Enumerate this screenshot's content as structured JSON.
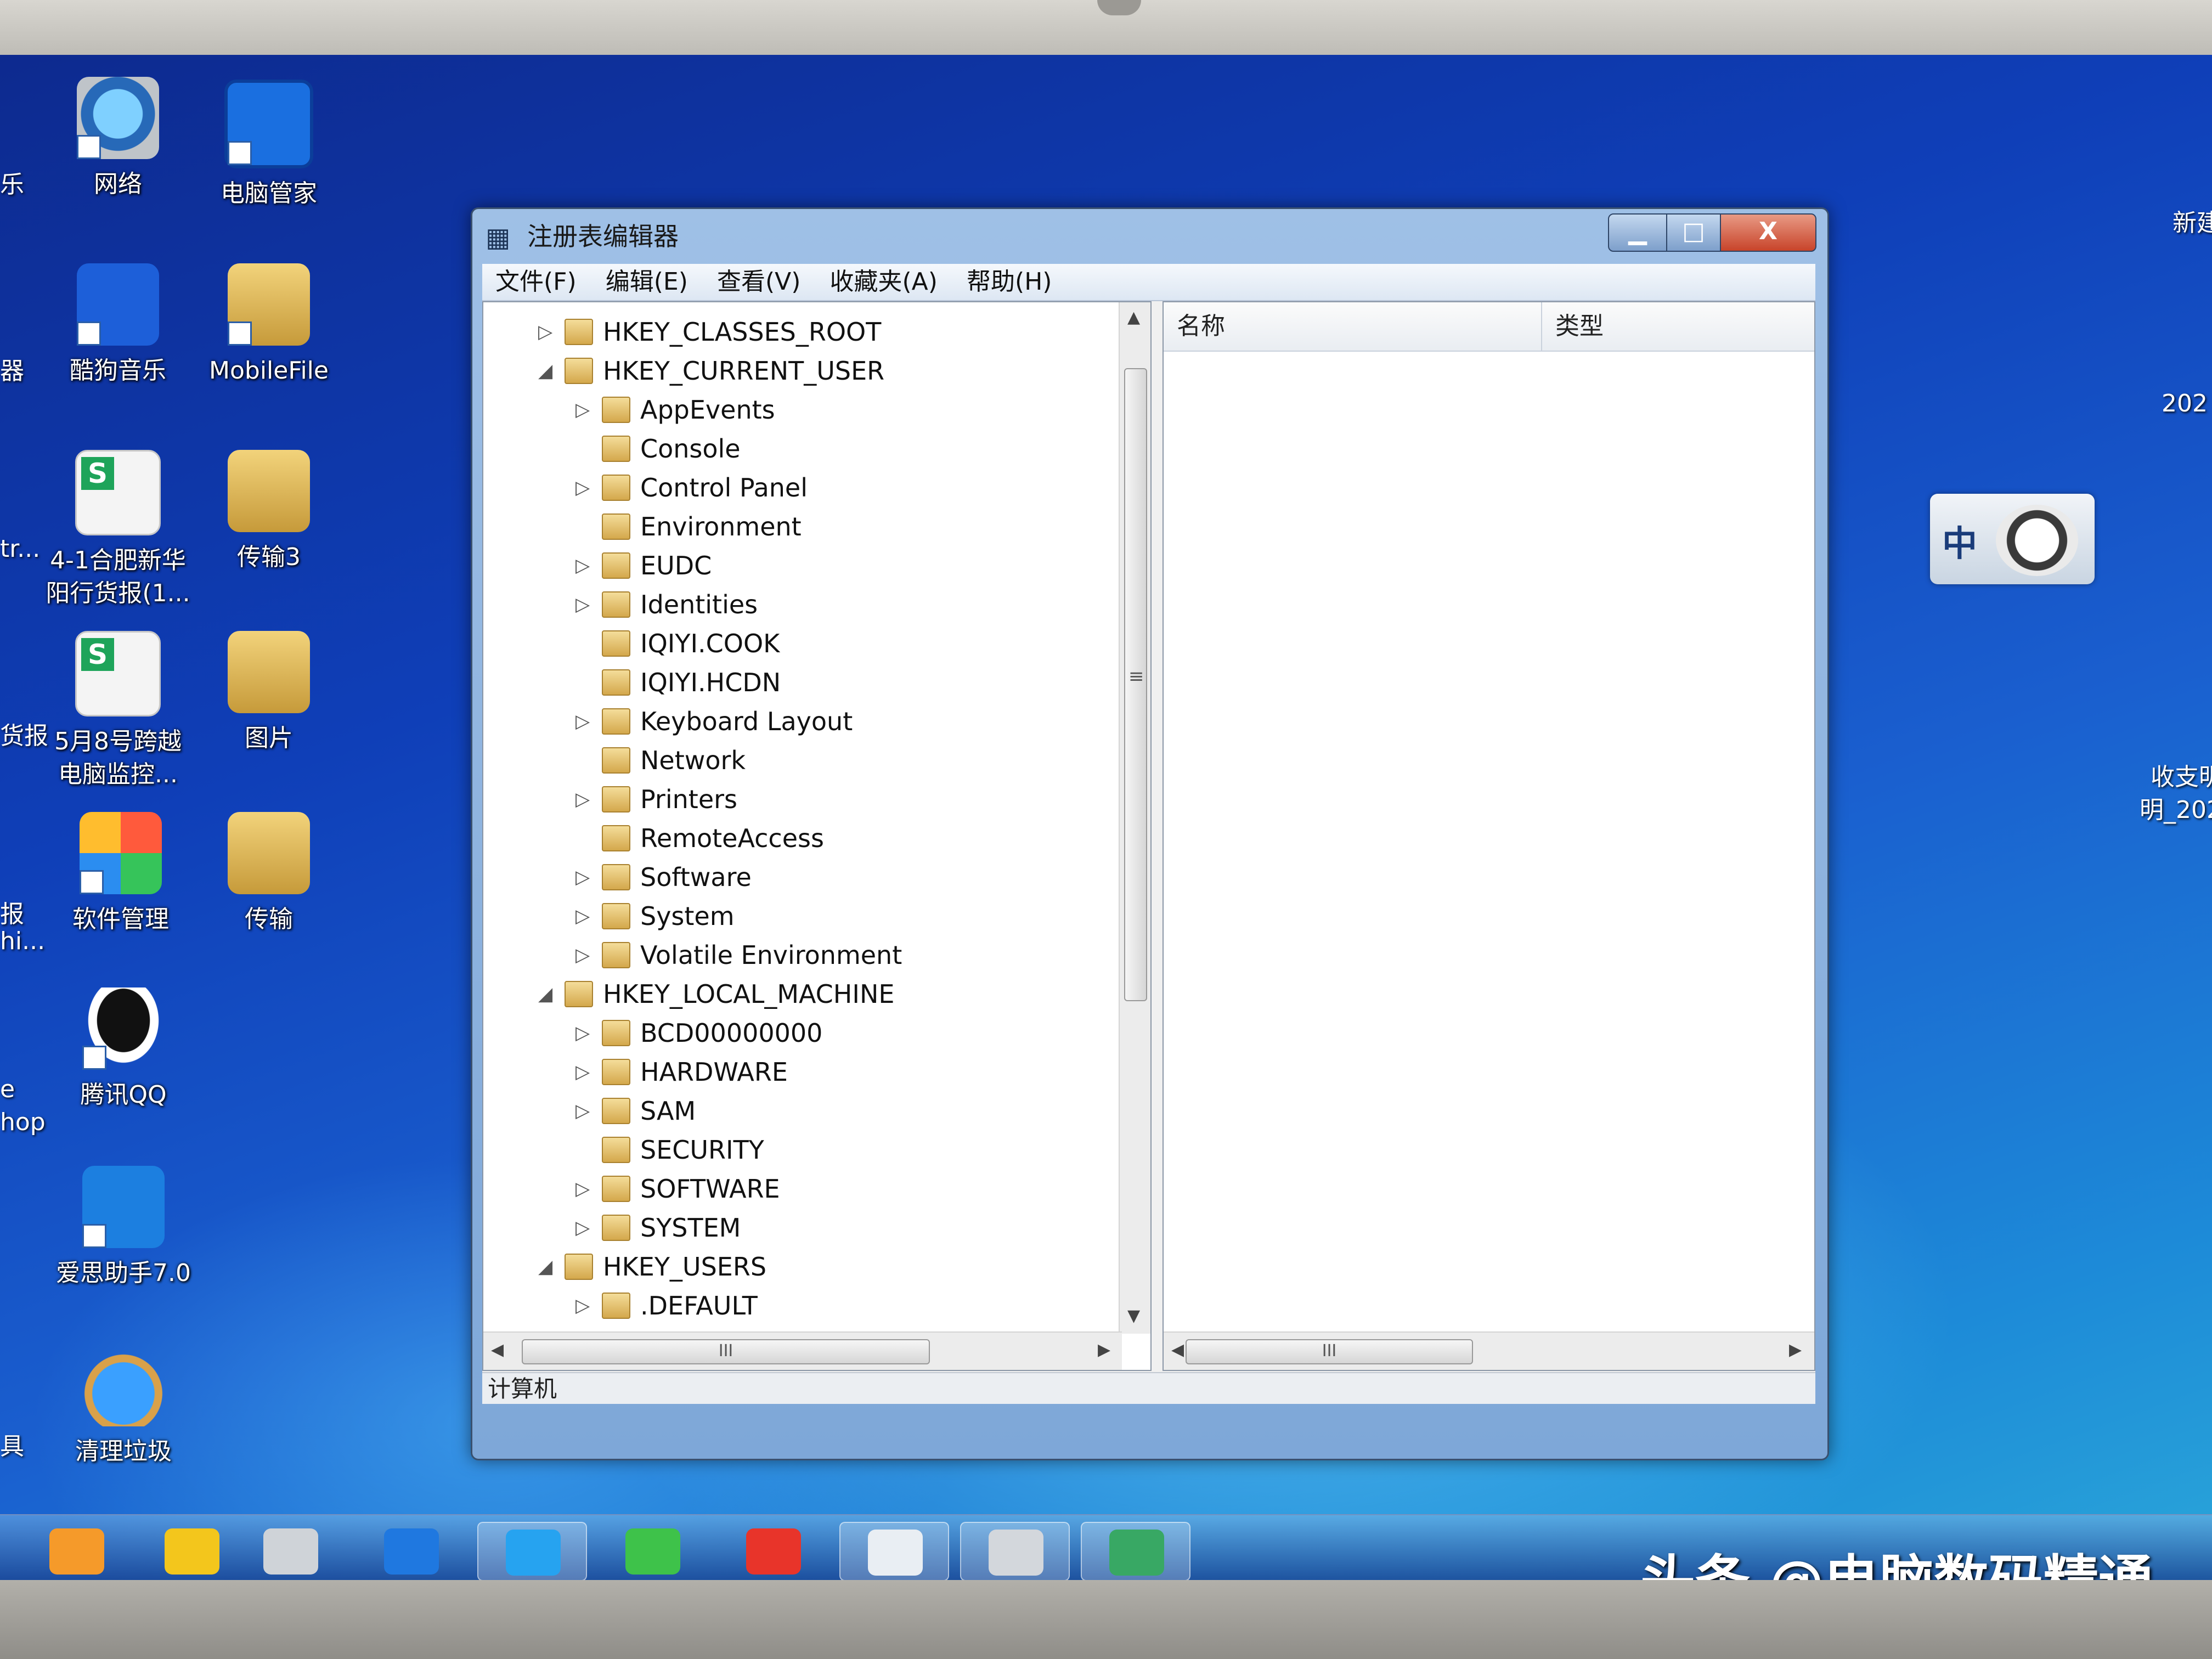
{
  "desktop": {
    "icons": [
      {
        "label": "网络",
        "icon": "network-icon"
      },
      {
        "label": "电脑管家",
        "icon": "pc-guard-icon"
      },
      {
        "label": "酷狗音乐",
        "icon": "kugou-music-icon"
      },
      {
        "label": "MobileFile",
        "icon": "folder-icon"
      },
      {
        "label": "4-1合肥新华",
        "label2": "阳行货报(1...",
        "icon": "spreadsheet-icon"
      },
      {
        "label": "传输3",
        "icon": "folder-icon"
      },
      {
        "label": "5月8号跨越",
        "label2": "电脑监控...",
        "icon": "spreadsheet-icon"
      },
      {
        "label": "图片",
        "icon": "folder-icon"
      },
      {
        "label": "软件管理",
        "icon": "software-manager-icon"
      },
      {
        "label": "传输",
        "icon": "folder-icon"
      },
      {
        "label": "腾讯QQ",
        "icon": "qq-penguin-icon"
      },
      {
        "label": "爱思助手7.0",
        "icon": "i4-assistant-icon"
      },
      {
        "label": "清理垃圾",
        "icon": "clean-trash-icon"
      }
    ],
    "edge_left": [
      "乐",
      "器",
      "tr...",
      "货报",
      "报",
      "hi...",
      "e",
      "hop",
      "具"
    ],
    "edge_right": [
      "新建",
      "202",
      "收支明",
      "明_202"
    ]
  },
  "window": {
    "title": "注册表编辑器",
    "controls": {
      "minimize": "▁",
      "maximize": "□",
      "close": "X"
    },
    "menu": [
      "文件(F)",
      "编辑(E)",
      "查看(V)",
      "收藏夹(A)",
      "帮助(H)"
    ],
    "tree": [
      {
        "label": "HKEY_CLASSES_ROOT",
        "level": 0,
        "toggle": "▷"
      },
      {
        "label": "HKEY_CURRENT_USER",
        "level": 0,
        "toggle": "◢"
      },
      {
        "label": "AppEvents",
        "level": 1,
        "toggle": "▷"
      },
      {
        "label": "Console",
        "level": 1,
        "toggle": ""
      },
      {
        "label": "Control Panel",
        "level": 1,
        "toggle": "▷"
      },
      {
        "label": "Environment",
        "level": 1,
        "toggle": ""
      },
      {
        "label": "EUDC",
        "level": 1,
        "toggle": "▷"
      },
      {
        "label": "Identities",
        "level": 1,
        "toggle": "▷"
      },
      {
        "label": "IQIYI.COOK",
        "level": 1,
        "toggle": ""
      },
      {
        "label": "IQIYI.HCDN",
        "level": 1,
        "toggle": ""
      },
      {
        "label": "Keyboard Layout",
        "level": 1,
        "toggle": "▷"
      },
      {
        "label": "Network",
        "level": 1,
        "toggle": ""
      },
      {
        "label": "Printers",
        "level": 1,
        "toggle": "▷"
      },
      {
        "label": "RemoteAccess",
        "level": 1,
        "toggle": ""
      },
      {
        "label": "Software",
        "level": 1,
        "toggle": "▷"
      },
      {
        "label": "System",
        "level": 1,
        "toggle": "▷"
      },
      {
        "label": "Volatile Environment",
        "level": 1,
        "toggle": "▷"
      },
      {
        "label": "HKEY_LOCAL_MACHINE",
        "level": 0,
        "toggle": "◢"
      },
      {
        "label": "BCD00000000",
        "level": 1,
        "toggle": "▷"
      },
      {
        "label": "HARDWARE",
        "level": 1,
        "toggle": "▷"
      },
      {
        "label": "SAM",
        "level": 1,
        "toggle": "▷"
      },
      {
        "label": "SECURITY",
        "level": 1,
        "toggle": ""
      },
      {
        "label": "SOFTWARE",
        "level": 1,
        "toggle": "▷"
      },
      {
        "label": "SYSTEM",
        "level": 1,
        "toggle": "▷"
      },
      {
        "label": "HKEY_USERS",
        "level": 0,
        "toggle": "◢"
      },
      {
        "label": ".DEFAULT",
        "level": 1,
        "toggle": "▷"
      }
    ],
    "list_columns": {
      "name": "名称",
      "type": "类型"
    },
    "scroll_grip": "III",
    "vscroll_grip": "≡",
    "status": "计算机"
  },
  "ime": {
    "mode": "中"
  },
  "taskbar": {
    "items": [
      "uc-browser-icon",
      "media-player-icon",
      "calculator-icon",
      "start-tiles-icon",
      "browser-icon",
      "wechat-icon",
      "wps-icon",
      "notepad-icon",
      "printer-icon",
      "regedit-icon"
    ],
    "active": [
      4,
      7,
      8,
      9
    ]
  },
  "watermark": "头条 @电脑数码精通"
}
